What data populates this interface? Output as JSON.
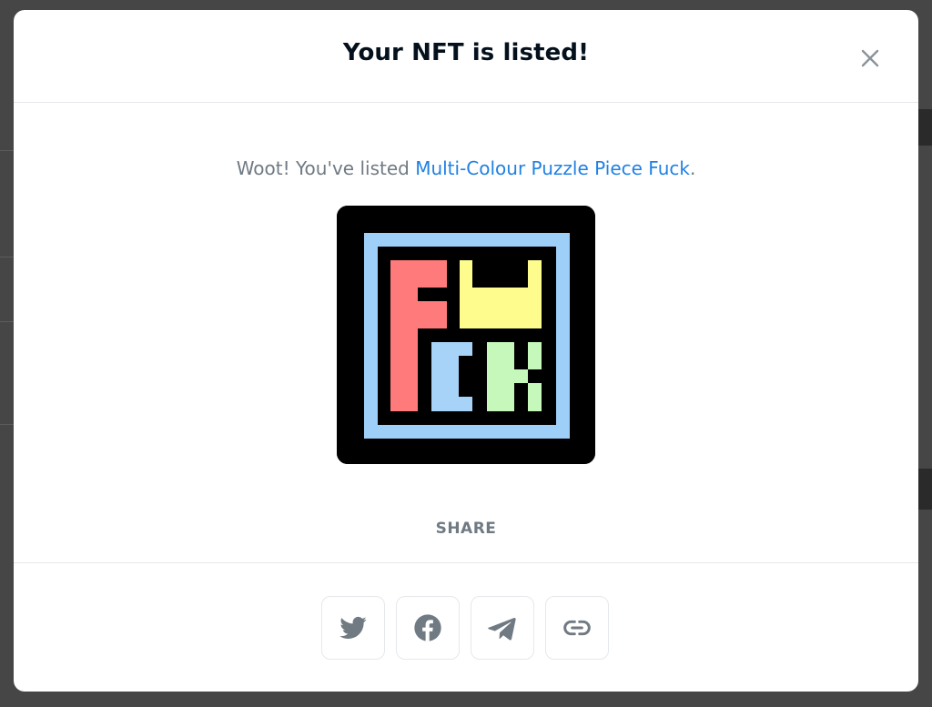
{
  "modal": {
    "title": "Your NFT is listed!",
    "message_prefix": "Woot! You've listed ",
    "nft_name": "Multi-Colour Puzzle Piece Fuck",
    "message_suffix": ".",
    "share_label": "SHARE",
    "share_buttons": [
      {
        "icon": "twitter-icon"
      },
      {
        "icon": "facebook-icon"
      },
      {
        "icon": "telegram-icon"
      },
      {
        "icon": "link-icon"
      }
    ]
  },
  "nft_art": {
    "colors": {
      "background": "#000000",
      "frame": "#9ecff8",
      "red": "#ff7b7b",
      "yellow": "#fdfc8c",
      "blue": "#a8d3f8",
      "green": "#c6f7bb"
    }
  },
  "colors": {
    "title": "#04111d",
    "text_secondary": "#707a83",
    "link": "#2081e2",
    "icon": "#707a83",
    "border": "#e5e8eb"
  }
}
